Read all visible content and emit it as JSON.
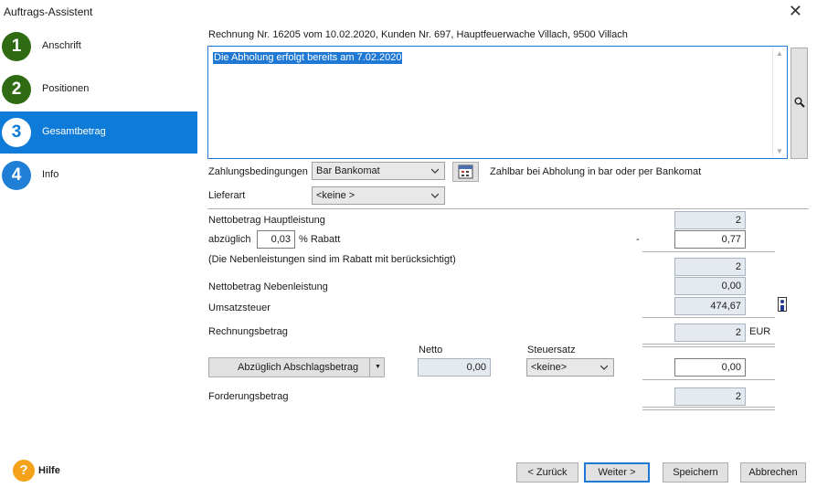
{
  "window": {
    "title": "Auftrags-Assistent",
    "close": "✕"
  },
  "steps": [
    {
      "num": "1",
      "label": "Anschrift"
    },
    {
      "num": "2",
      "label": "Positionen"
    },
    {
      "num": "3",
      "label": "Gesamtbetrag"
    },
    {
      "num": "4",
      "label": "Info"
    }
  ],
  "help": {
    "icon": "?",
    "label": "Hilfe"
  },
  "header": "Rechnung Nr. 16205 vom 10.02.2020, Kunden Nr. 697, Hauptfeuerwache Villach, 9500 Villach",
  "memo": {
    "text": "Die Abholung erfolgt bereits am 7.02.2020"
  },
  "zahlung": {
    "label": "Zahlungsbedingungen",
    "value": "Bar Bankomat",
    "description": "Zahlbar bei Abholung in bar oder per Bankomat"
  },
  "lieferart": {
    "label": "Lieferart",
    "value": "<keine >"
  },
  "netto_haupt": {
    "label": "Nettobetrag Hauptleistung",
    "value": "2"
  },
  "rabatt": {
    "prefix": "abzüglich",
    "percent": "0,03",
    "suffix": "% Rabatt",
    "minus": "-",
    "value": "0,77"
  },
  "neben_note": {
    "label": "(Die Nebenleistungen sind im Rabatt mit berücksichtigt)",
    "value": "2"
  },
  "netto_neben": {
    "label": "Nettobetrag Nebenleistung",
    "value": "0,00"
  },
  "ust": {
    "label": "Umsatzsteuer",
    "value": "474,67"
  },
  "rechnung": {
    "label": "Rechnungsbetrag",
    "value": "2",
    "currency": "EUR"
  },
  "abschlag": {
    "button": "Abzüglich Abschlagsbetrag",
    "netto_label": "Netto",
    "netto_value": "0,00",
    "steuer_label": "Steuersatz",
    "steuer_value": "<keine>",
    "value": "0,00"
  },
  "forderung": {
    "label": "Forderungsbetrag",
    "value": "2"
  },
  "buttons": {
    "back": "< Zurück",
    "next": "Weiter >",
    "save": "Speichern",
    "cancel": "Abbrechen"
  }
}
